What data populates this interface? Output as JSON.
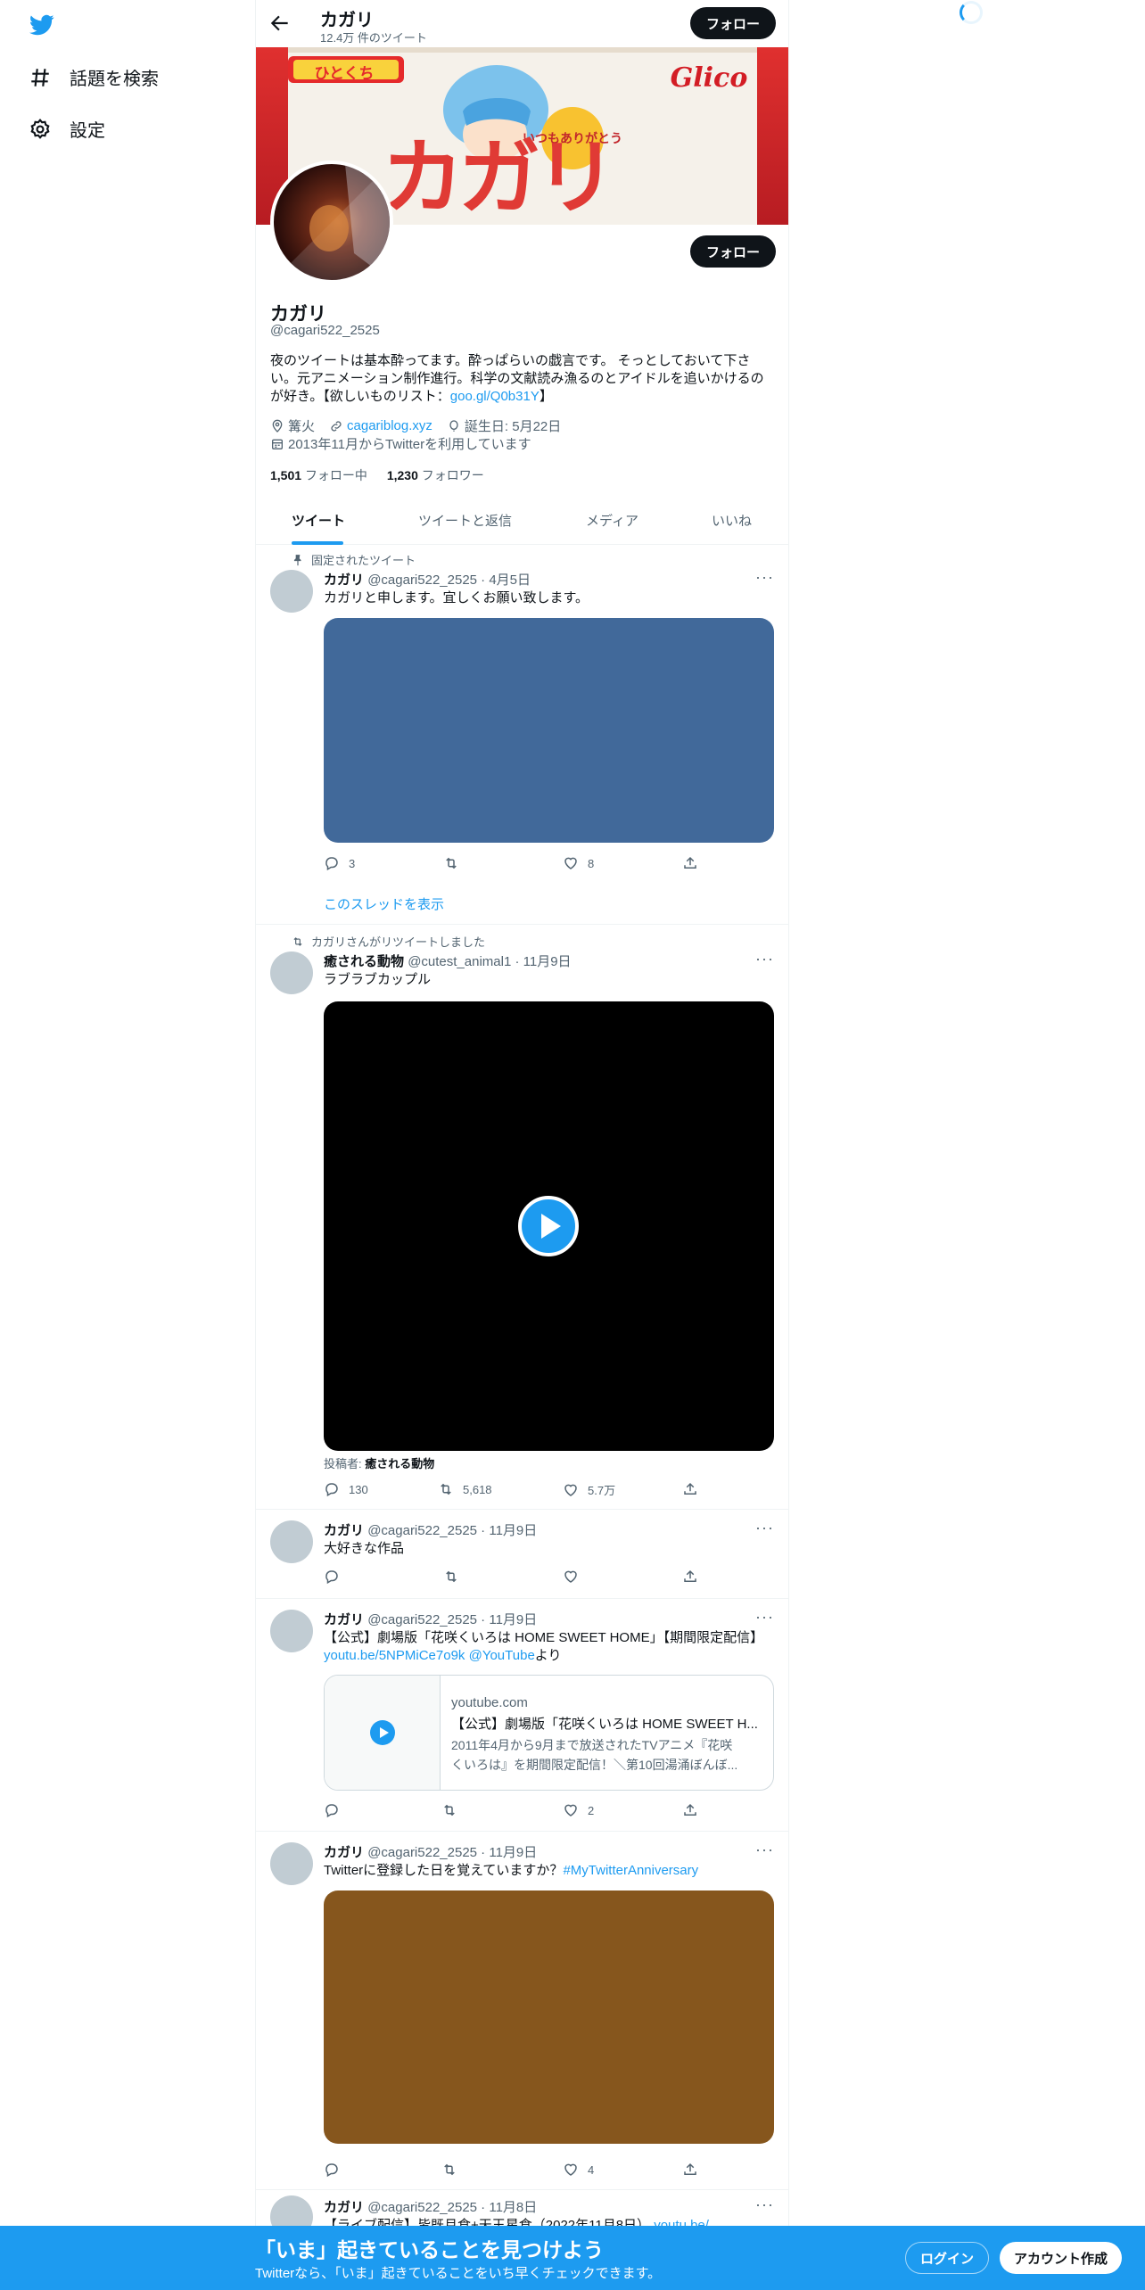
{
  "nav": {
    "explore_label": "話題を検索",
    "settings_label": "設定"
  },
  "header": {
    "title": "カガリ",
    "subtitle": "12.4万 件のツイート",
    "follow_label": "フォロー"
  },
  "banner": {
    "label_top": "ひとくち",
    "brand": "Glico",
    "bubble": "いつもありがとう",
    "product": "カガリ"
  },
  "profile": {
    "name": "カガリ",
    "handle": "@cagari522_2525",
    "follow_label": "フォロー",
    "bio_text": "夜のツイートは基本酔ってます。酔っぱらいの戯言です。 そっとしておいて下さい。元アニメーション制作進行。科学の文献読み漁るのとアイドルを追いかけるのが好き。【欲しいものリスト：",
    "bio_link": "goo.gl/Q0b31Y",
    "bio_end": "】",
    "location": "篝火",
    "url": "cagariblog.xyz",
    "birthday": "誕生日: 5月22日",
    "joined": "2013年11月からTwitterを利用しています",
    "following_count": "1,501",
    "following_label": "フォロー中",
    "followers_count": "1,230",
    "followers_label": "フォロワー"
  },
  "tabs": [
    {
      "label": "ツイート"
    },
    {
      "label": "ツイートと返信"
    },
    {
      "label": "メディア"
    },
    {
      "label": "いいね"
    }
  ],
  "tweets": [
    {
      "context": "固定されたツイート",
      "name": "カガリ",
      "meta": "@cagari522_2525 · 4月5日",
      "text": "カガリと申します。宜しくお願い致します。",
      "media_color": "#41699a",
      "replies": "3",
      "retweets": "",
      "likes": "8",
      "thread_link": "このスレッドを表示"
    },
    {
      "context": "カガリさんがリツイートしました",
      "name": "癒される動物",
      "meta": "@cutest_animal1 · 11月9日",
      "text": "ラブラブカップル",
      "poster_label": "投稿者:",
      "poster_name": "癒される動物",
      "replies": "130",
      "retweets": "5,618",
      "likes": "5.7万"
    },
    {
      "name": "カガリ",
      "meta": "@cagari522_2525 · 11月9日",
      "text": "大好きな作品",
      "replies": "",
      "retweets": "",
      "likes": ""
    },
    {
      "name": "カガリ",
      "meta": "@cagari522_2525 · 11月9日",
      "text": "【公式】劇場版「花咲くいろは HOME SWEET HOME」【期間限定配信】",
      "link1": "youtu.be/5NPMiCe7o9k",
      "link2": "@YouTube",
      "text_end": "より",
      "card_domain": "youtube.com",
      "card_title": "【公式】劇場版「花咲くいろは HOME SWEET H...",
      "card_desc1": "2011年4月から9月まで放送されたTVアニメ『花咲",
      "card_desc2": "くいろは』を期間限定配信！＼第10回湯涌ぼんぼ...",
      "replies": "",
      "retweets": "",
      "likes": "2"
    },
    {
      "name": "カガリ",
      "meta": "@cagari522_2525 · 11月9日",
      "text": "Twitterに登録した日を覚えていますか？",
      "hashtag": "#MyTwitterAnniversary",
      "media_color": "#86561d",
      "replies": "",
      "retweets": "",
      "likes": "4"
    },
    {
      "name": "カガリ",
      "meta": "@cagari522_2525 · 11月8日",
      "text": "【ライブ配信】皆既月食+天王星食（2022年11月8日）",
      "link1": "youtu.be/"
    }
  ],
  "bottom": {
    "title": "「いま」起きていることを見つけよう",
    "subtitle": "Twitterなら、「いま」起きていることをいち早くチェックできます。",
    "login_label": "ログイン",
    "signup_label": "アカウント作成"
  },
  "colors": {
    "accent": "#1d9bf0",
    "banner_red": "#d8262b"
  }
}
